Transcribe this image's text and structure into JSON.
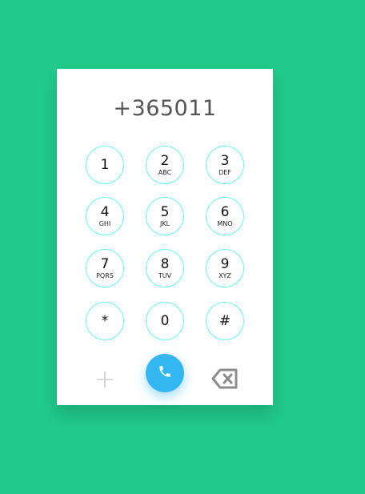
{
  "dialer": {
    "number": "+365011",
    "keys": [
      {
        "digit": "1",
        "letters": ""
      },
      {
        "digit": "2",
        "letters": "ABC"
      },
      {
        "digit": "3",
        "letters": "DEF"
      },
      {
        "digit": "4",
        "letters": "GHI"
      },
      {
        "digit": "5",
        "letters": "JKL"
      },
      {
        "digit": "6",
        "letters": "MNO"
      },
      {
        "digit": "7",
        "letters": "PQRS"
      },
      {
        "digit": "8",
        "letters": "TUV"
      },
      {
        "digit": "9",
        "letters": "XYZ"
      },
      {
        "digit": "*",
        "letters": ""
      },
      {
        "digit": "0",
        "letters": ""
      },
      {
        "digit": "#",
        "letters": ""
      }
    ],
    "actions": {
      "add_icon": "plus-icon",
      "call_icon": "phone-icon",
      "delete_icon": "backspace-icon"
    }
  },
  "colors": {
    "background": "#21c98a",
    "card": "#ffffff",
    "key_border": "#66f3f3",
    "call_button": "#34b7f1",
    "display_text": "#555555"
  }
}
